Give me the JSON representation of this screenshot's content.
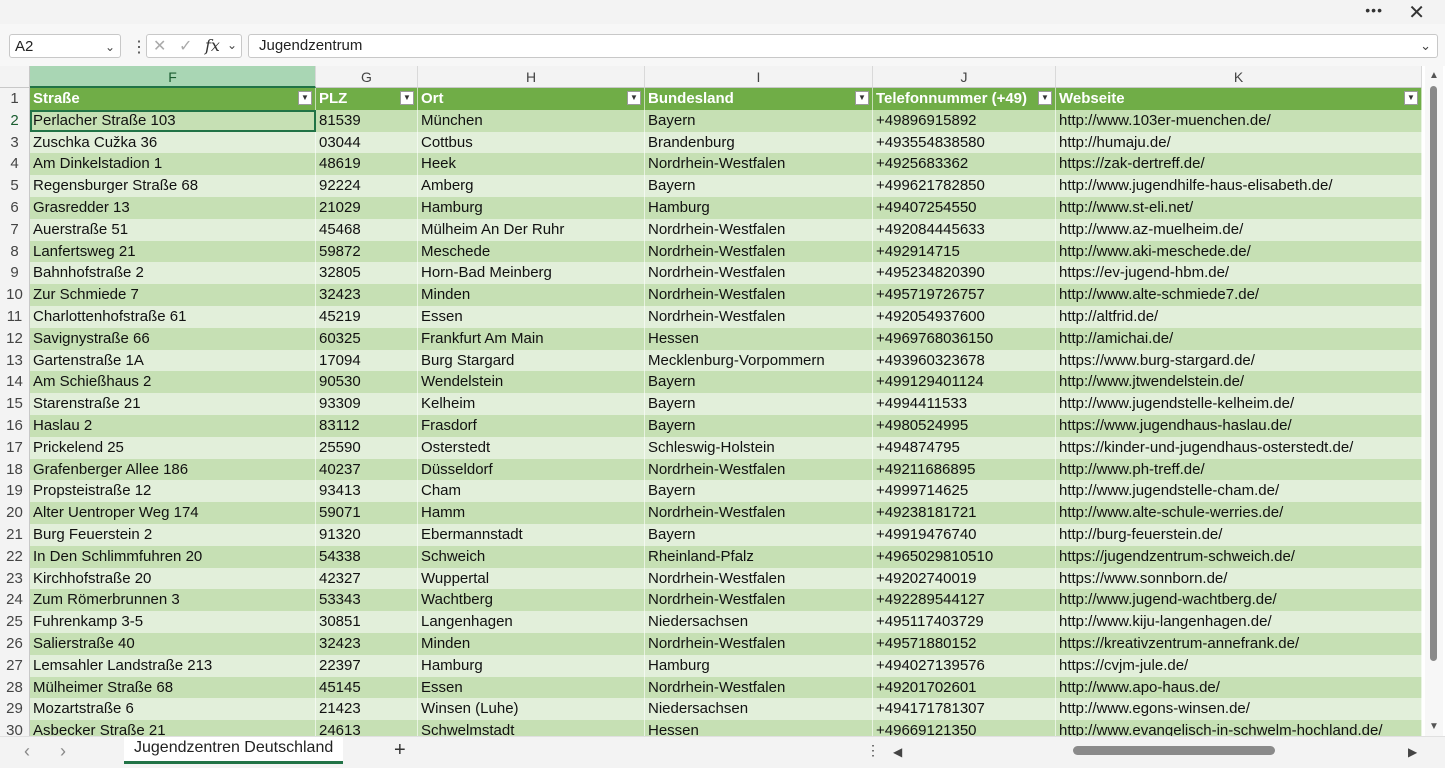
{
  "window": {
    "more_label": "•••",
    "close_label": "✕"
  },
  "formula_bar": {
    "name_box": "A2",
    "cancel_icon": "✕",
    "enter_icon": "✓",
    "fx_label": "fx",
    "formula_value": "Jugendzentrum"
  },
  "columns": [
    "F",
    "G",
    "H",
    "I",
    "J",
    "K"
  ],
  "selected_column": "F",
  "headers": [
    "Straße",
    "PLZ",
    "Ort",
    "Bundesland",
    "Telefonnummer (+49)",
    "Webseite"
  ],
  "rows": [
    {
      "n": "2",
      "cells": [
        "Perlacher Straße 103",
        "81539",
        "München",
        "Bayern",
        "+49896915892",
        "http://www.103er-muenchen.de/"
      ]
    },
    {
      "n": "3",
      "cells": [
        "Zuschka Cužka 36",
        "03044",
        "Cottbus",
        "Brandenburg",
        "+493554838580",
        "http://humaju.de/"
      ]
    },
    {
      "n": "4",
      "cells": [
        "Am Dinkelstadion 1",
        "48619",
        "Heek",
        "Nordrhein-Westfalen",
        "+4925683362",
        "https://zak-dertreff.de/"
      ]
    },
    {
      "n": "5",
      "cells": [
        "Regensburger Straße 68",
        "92224",
        "Amberg",
        "Bayern",
        "+499621782850",
        "http://www.jugendhilfe-haus-elisabeth.de/"
      ]
    },
    {
      "n": "6",
      "cells": [
        "Grasredder 13",
        "21029",
        "Hamburg",
        "Hamburg",
        "+49407254550",
        "http://www.st-eli.net/"
      ]
    },
    {
      "n": "7",
      "cells": [
        "Auerstraße 51",
        "45468",
        "Mülheim An Der Ruhr",
        "Nordrhein-Westfalen",
        "+492084445633",
        "http://www.az-muelheim.de/"
      ]
    },
    {
      "n": "8",
      "cells": [
        "Lanfertsweg 21",
        "59872",
        "Meschede",
        "Nordrhein-Westfalen",
        "+492914715",
        "http://www.aki-meschede.de/"
      ]
    },
    {
      "n": "9",
      "cells": [
        "Bahnhofstraße 2",
        "32805",
        "Horn-Bad Meinberg",
        "Nordrhein-Westfalen",
        "+495234820390",
        "https://ev-jugend-hbm.de/"
      ]
    },
    {
      "n": "10",
      "cells": [
        "Zur Schmiede 7",
        "32423",
        "Minden",
        "Nordrhein-Westfalen",
        "+495719726757",
        "http://www.alte-schmiede7.de/"
      ]
    },
    {
      "n": "11",
      "cells": [
        "Charlottenhofstraße 61",
        "45219",
        "Essen",
        "Nordrhein-Westfalen",
        "+492054937600",
        "http://altfrid.de/"
      ]
    },
    {
      "n": "12",
      "cells": [
        "Savignystraße 66",
        "60325",
        "Frankfurt Am Main",
        "Hessen",
        "+4969768036150",
        "http://amichai.de/"
      ]
    },
    {
      "n": "13",
      "cells": [
        "Gartenstraße 1A",
        "17094",
        "Burg Stargard",
        "Mecklenburg-Vorpommern",
        "+493960323678",
        "https://www.burg-stargard.de/"
      ]
    },
    {
      "n": "14",
      "cells": [
        "Am Schießhaus 2",
        "90530",
        "Wendelstein",
        "Bayern",
        "+499129401124",
        "http://www.jtwendelstein.de/"
      ]
    },
    {
      "n": "15",
      "cells": [
        "Starenstraße 21",
        "93309",
        "Kelheim",
        "Bayern",
        "+4994411533",
        "http://www.jugendstelle-kelheim.de/"
      ]
    },
    {
      "n": "16",
      "cells": [
        "Haslau 2",
        "83112",
        "Frasdorf",
        "Bayern",
        "+4980524995",
        "https://www.jugendhaus-haslau.de/"
      ]
    },
    {
      "n": "17",
      "cells": [
        "Prickelend 25",
        "25590",
        "Osterstedt",
        "Schleswig-Holstein",
        "+494874795",
        "https://kinder-und-jugendhaus-osterstedt.de/"
      ]
    },
    {
      "n": "18",
      "cells": [
        "Grafenberger Allee 186",
        "40237",
        "Düsseldorf",
        "Nordrhein-Westfalen",
        "+49211686895",
        "http://www.ph-treff.de/"
      ]
    },
    {
      "n": "19",
      "cells": [
        "Propsteistraße 12",
        "93413",
        "Cham",
        "Bayern",
        "+4999714625",
        "http://www.jugendstelle-cham.de/"
      ]
    },
    {
      "n": "20",
      "cells": [
        "Alter Uentroper Weg 174",
        "59071",
        "Hamm",
        "Nordrhein-Westfalen",
        "+49238181721",
        "http://www.alte-schule-werries.de/"
      ]
    },
    {
      "n": "21",
      "cells": [
        "Burg Feuerstein 2",
        "91320",
        "Ebermannstadt",
        "Bayern",
        "+49919476740",
        "http://burg-feuerstein.de/"
      ]
    },
    {
      "n": "22",
      "cells": [
        "In Den Schlimmfuhren 20",
        "54338",
        "Schweich",
        "Rheinland-Pfalz",
        "+4965029810510",
        "https://jugendzentrum-schweich.de/"
      ]
    },
    {
      "n": "23",
      "cells": [
        "Kirchhofstraße 20",
        "42327",
        "Wuppertal",
        "Nordrhein-Westfalen",
        "+49202740019",
        "https://www.sonnborn.de/"
      ]
    },
    {
      "n": "24",
      "cells": [
        "Zum Römerbrunnen 3",
        "53343",
        "Wachtberg",
        "Nordrhein-Westfalen",
        "+492289544127",
        "http://www.jugend-wachtberg.de/"
      ]
    },
    {
      "n": "25",
      "cells": [
        "Fuhrenkamp 3-5",
        "30851",
        "Langenhagen",
        "Niedersachsen",
        "+495117403729",
        "http://www.kiju-langenhagen.de/"
      ]
    },
    {
      "n": "26",
      "cells": [
        "Salierstraße 40",
        "32423",
        "Minden",
        "Nordrhein-Westfalen",
        "+49571880152",
        "https://kreativzentrum-annefrank.de/"
      ]
    },
    {
      "n": "27",
      "cells": [
        "Lemsahler Landstraße 213",
        "22397",
        "Hamburg",
        "Hamburg",
        "+494027139576",
        "https://cvjm-jule.de/"
      ]
    },
    {
      "n": "28",
      "cells": [
        "Mülheimer Straße 68",
        "45145",
        "Essen",
        "Nordrhein-Westfalen",
        "+49201702601",
        "http://www.apo-haus.de/"
      ]
    },
    {
      "n": "29",
      "cells": [
        "Mozartstraße 6",
        "21423",
        "Winsen (Luhe)",
        "Niedersachsen",
        "+494171781307",
        "http://www.egons-winsen.de/"
      ]
    },
    {
      "n": "30",
      "cells": [
        "Asbecker Straße 21",
        "24613",
        "Schwelmstadt",
        "Hessen",
        "+49669121350",
        "http://www.evangelisch-in-schwelm-hochland.de/"
      ]
    }
  ],
  "sheet_tab": "Jugendzentren Deutschland",
  "add_sheet_label": "+",
  "colors": {
    "header_green": "#70ad47",
    "band_dark": "#c6e0b4",
    "band_light": "#e2efda",
    "accent": "#217346"
  }
}
